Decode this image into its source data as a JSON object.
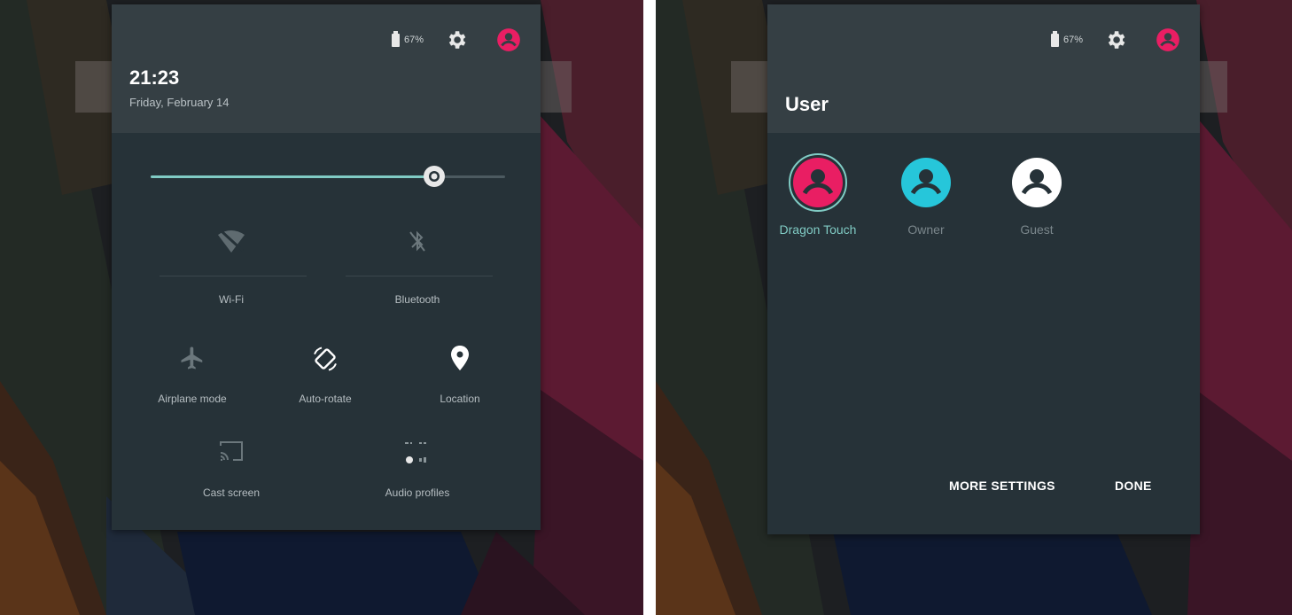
{
  "left_screen": {
    "status": {
      "battery_percent": "67%"
    },
    "clock": "21:23",
    "date": "Friday, February 14",
    "brightness": {
      "level": 0.8
    },
    "tiles": [
      {
        "id": "wifi",
        "label": "Wi-Fi",
        "icon": "wifi-off-icon",
        "active": false
      },
      {
        "id": "bluetooth",
        "label": "Bluetooth",
        "icon": "bluetooth-off-icon",
        "active": false
      },
      {
        "id": "airplane",
        "label": "Airplane mode",
        "icon": "airplane-icon",
        "active": false
      },
      {
        "id": "autorotate",
        "label": "Auto-rotate",
        "icon": "screen-rotation-icon",
        "active": true
      },
      {
        "id": "location",
        "label": "Location",
        "icon": "location-pin-icon",
        "active": true
      },
      {
        "id": "cast",
        "label": "Cast screen",
        "icon": "cast-icon",
        "active": false
      },
      {
        "id": "audio",
        "label": "Audio profiles",
        "icon": "audio-profiles-icon",
        "active": false
      }
    ]
  },
  "right_screen": {
    "status": {
      "battery_percent": "67%"
    },
    "title": "User",
    "users": [
      {
        "name": "Dragon Touch",
        "color": "#e91e63",
        "selected": true
      },
      {
        "name": "Owner",
        "color": "#26c6da",
        "selected": false
      },
      {
        "name": "Guest",
        "color": "#ffffff",
        "selected": false
      }
    ],
    "actions": {
      "more_settings": "MORE SETTINGS",
      "done": "DONE"
    }
  },
  "colors": {
    "accent": "#80cbc4",
    "user_accent": "#e91e63",
    "panel": "#263238",
    "panel_header": "#353f44"
  }
}
